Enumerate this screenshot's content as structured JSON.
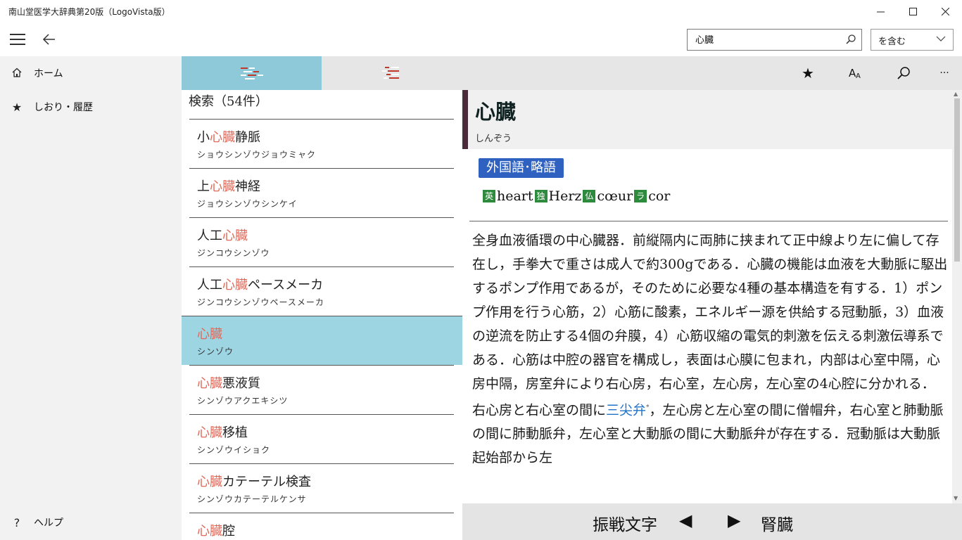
{
  "window": {
    "title": "南山堂医学大辞典第20版（LogoVista版）",
    "minimize_icon": "minimize-icon",
    "maximize_icon": "maximize-icon",
    "close_icon": "close-icon"
  },
  "appbar": {
    "search_value": "心臓",
    "search_placeholder": "",
    "mode_value": "を含む"
  },
  "nav": {
    "items": [
      {
        "icon": "home-icon",
        "glyph": "⌂",
        "label": "ホーム"
      },
      {
        "icon": "star-icon",
        "glyph": "★",
        "label": "しおり・履歴"
      },
      {
        "icon": "help-icon",
        "glyph": "?",
        "label": "ヘルプ"
      }
    ]
  },
  "toolbar": {
    "tabs": [
      "list-view-icon",
      "index-view-icon"
    ],
    "tools": [
      {
        "icon": "star-icon",
        "glyph": "★"
      },
      {
        "icon": "font-size-icon",
        "glyph": "A"
      },
      {
        "icon": "search-icon",
        "glyph": ""
      },
      {
        "icon": "more-icon",
        "glyph": "···"
      }
    ]
  },
  "results": {
    "header": "検索（54件）",
    "items": [
      {
        "pre": "小",
        "hl": "心臓",
        "post": "静脈",
        "kana": "ショウシンゾウジョウミャク",
        "selected": false
      },
      {
        "pre": "上",
        "hl": "心臓",
        "post": "神経",
        "kana": "ジョウシンゾウシンケイ",
        "selected": false
      },
      {
        "pre": "人工",
        "hl": "心臓",
        "post": "",
        "kana": "ジンコウシンゾウ",
        "selected": false
      },
      {
        "pre": "人工",
        "hl": "心臓",
        "post": "ペースメーカ",
        "kana": "ジンコウシンゾウペースメーカ",
        "selected": false
      },
      {
        "pre": "",
        "hl": "心臓",
        "post": "",
        "kana": "シンゾウ",
        "selected": true
      },
      {
        "pre": "",
        "hl": "心臓",
        "post": "悪液質",
        "kana": "シンゾウアクエキシツ",
        "selected": false
      },
      {
        "pre": "",
        "hl": "心臓",
        "post": "移植",
        "kana": "シンゾウイショク",
        "selected": false
      },
      {
        "pre": "",
        "hl": "心臓",
        "post": "カテーテル検査",
        "kana": "シンゾウカテーテルケンサ",
        "selected": false
      },
      {
        "pre": "",
        "hl": "心臓",
        "post": "腔",
        "kana": "",
        "selected": false
      }
    ]
  },
  "entry": {
    "word": "心臓",
    "reading": "しんぞう",
    "badge": "外国語･略語",
    "foreign": [
      {
        "tag": "英",
        "word": "heart"
      },
      {
        "tag": "独",
        "word": "Herz"
      },
      {
        "tag": "仏",
        "word": "cœur"
      },
      {
        "tag": "ラ",
        "word": "cor"
      }
    ],
    "body_before_link": "全身血液循環の中心臓器．前縦隔内に両肺に挟まれて正中線より左に偏して存在し，手拳大で重さは成人で約300gである．心臓の機能は血液を大動脈に駆出するポンプ作用であるが，そのために必要な4種の基本構造を有する．1）ポンプ作用を行う心筋，2）心筋に酸素，エネルギー源を供給する冠動脈，3）血液の逆流を防止する4個の弁膜，4）心筋収縮の電気的刺激を伝える刺激伝導系である．心筋は中腔の器官を構成し，表面は心膜に包まれ，内部は心室中隔，心房中隔，房室弁により右心房，右心室，左心房，左心室の4心腔に分かれる．右心房と右心室の間に",
    "link": "三尖弁",
    "link_mark": "*",
    "body_after_link": "，左心房と左心室の間に僧帽弁，右心室と肺動脈の間に肺動脈弁，左心室と大動脈の間に大動脈弁が存在する．冠動脈は大動脈起始部から左"
  },
  "bottom": {
    "prev_term": "振戦文字",
    "prev_arrow": "◀",
    "next_arrow": "▶",
    "next_term": "腎臓"
  }
}
